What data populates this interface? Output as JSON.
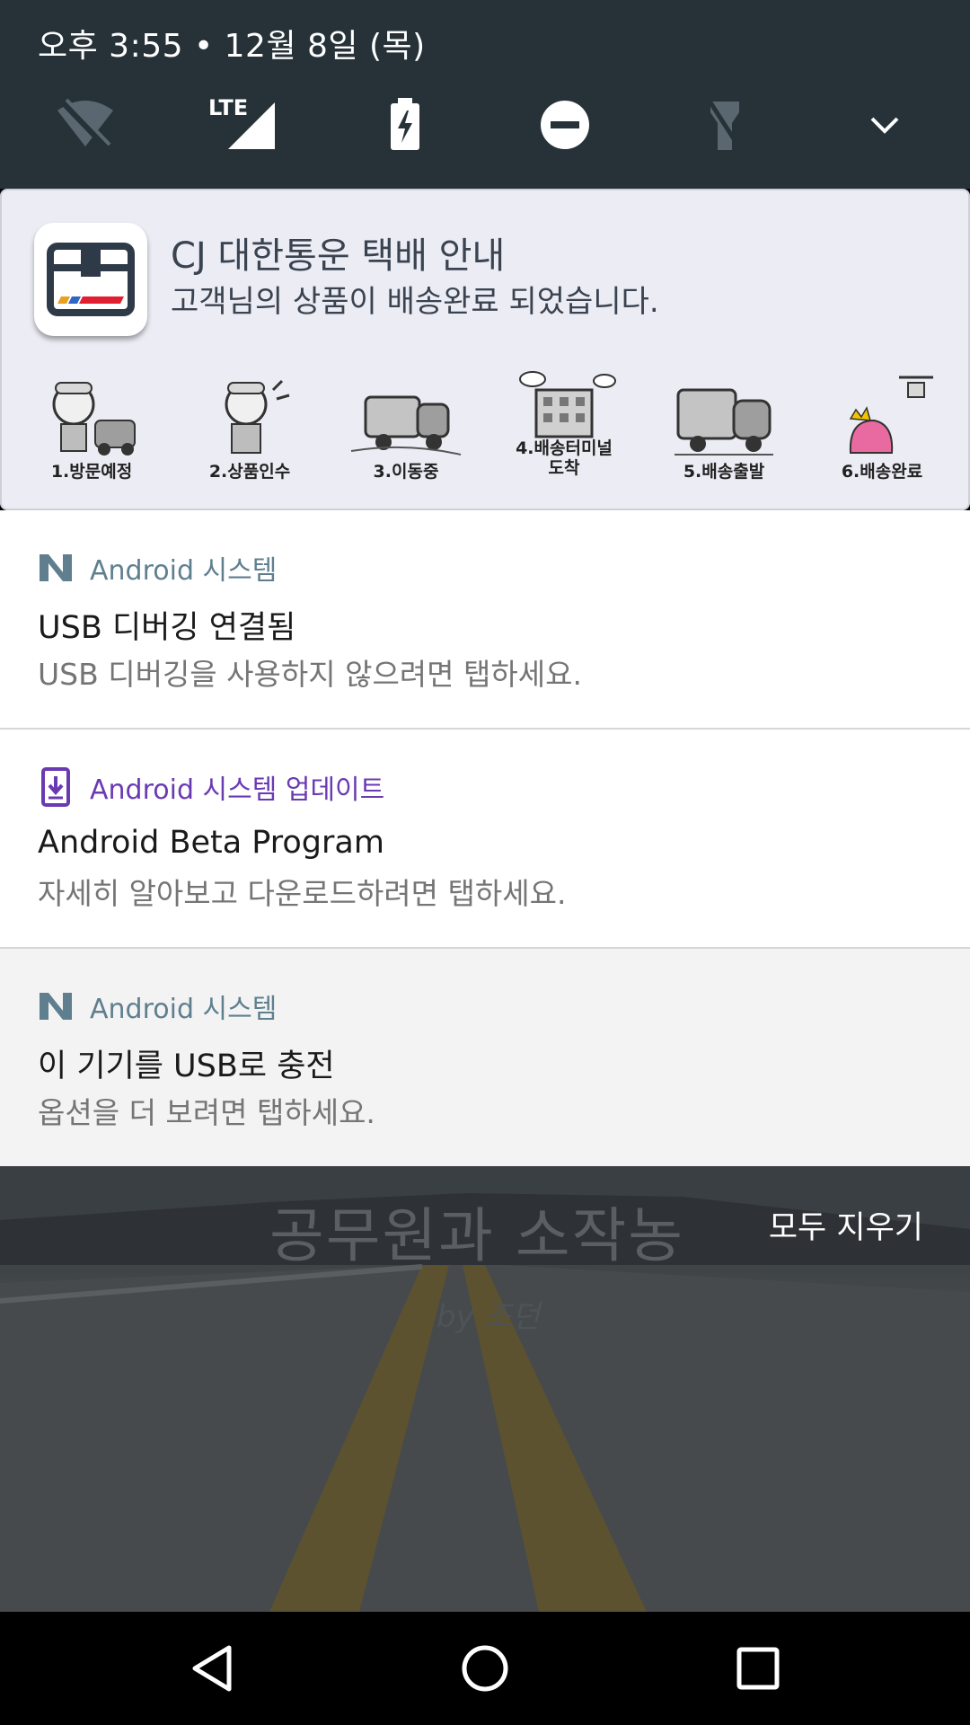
{
  "status_bar": {
    "datetime": "오후 3:55 • 12월 8일 (목)",
    "network_label": "LTE"
  },
  "quick_settings": {
    "icons": [
      "wifi-off-icon",
      "lte-signal-icon",
      "battery-charging-icon",
      "do-not-disturb-icon",
      "flashlight-off-icon",
      "expand-icon"
    ]
  },
  "cj_notification": {
    "title": "CJ 대한통운 택배 안내",
    "body": "고객님의 상품이 배송완료 되었습니다.",
    "steps": [
      {
        "label": "1.방문예정"
      },
      {
        "label": "2.상품인수"
      },
      {
        "label": "3.이동중"
      },
      {
        "label": "4.배송터미널 도착"
      },
      {
        "label": "5.배송출발"
      },
      {
        "label": "6.배송완료"
      }
    ]
  },
  "notifications": [
    {
      "app": "Android 시스템",
      "app_color": "#5f7f8f",
      "title": "USB 디버깅 연결됨",
      "text": "USB 디버깅을 사용하지 않으려면 탭하세요."
    },
    {
      "app": "Android 시스템 업데이트",
      "app_color": "#6a3ab2",
      "title": "Android Beta Program",
      "text": "자세히 알아보고 다운로드하려면 탭하세요."
    },
    {
      "app": "Android 시스템",
      "app_color": "#5f7f8f",
      "title": "이 기기를 USB로 충전",
      "text": "옵션을 더 보려면 탭하세요."
    }
  ],
  "wallpaper": {
    "title": "공무원과 소작농",
    "subtitle": "by 조던"
  },
  "clear_all_label": "모두 지우기",
  "navigation": [
    "back-icon",
    "home-icon",
    "recents-icon"
  ]
}
